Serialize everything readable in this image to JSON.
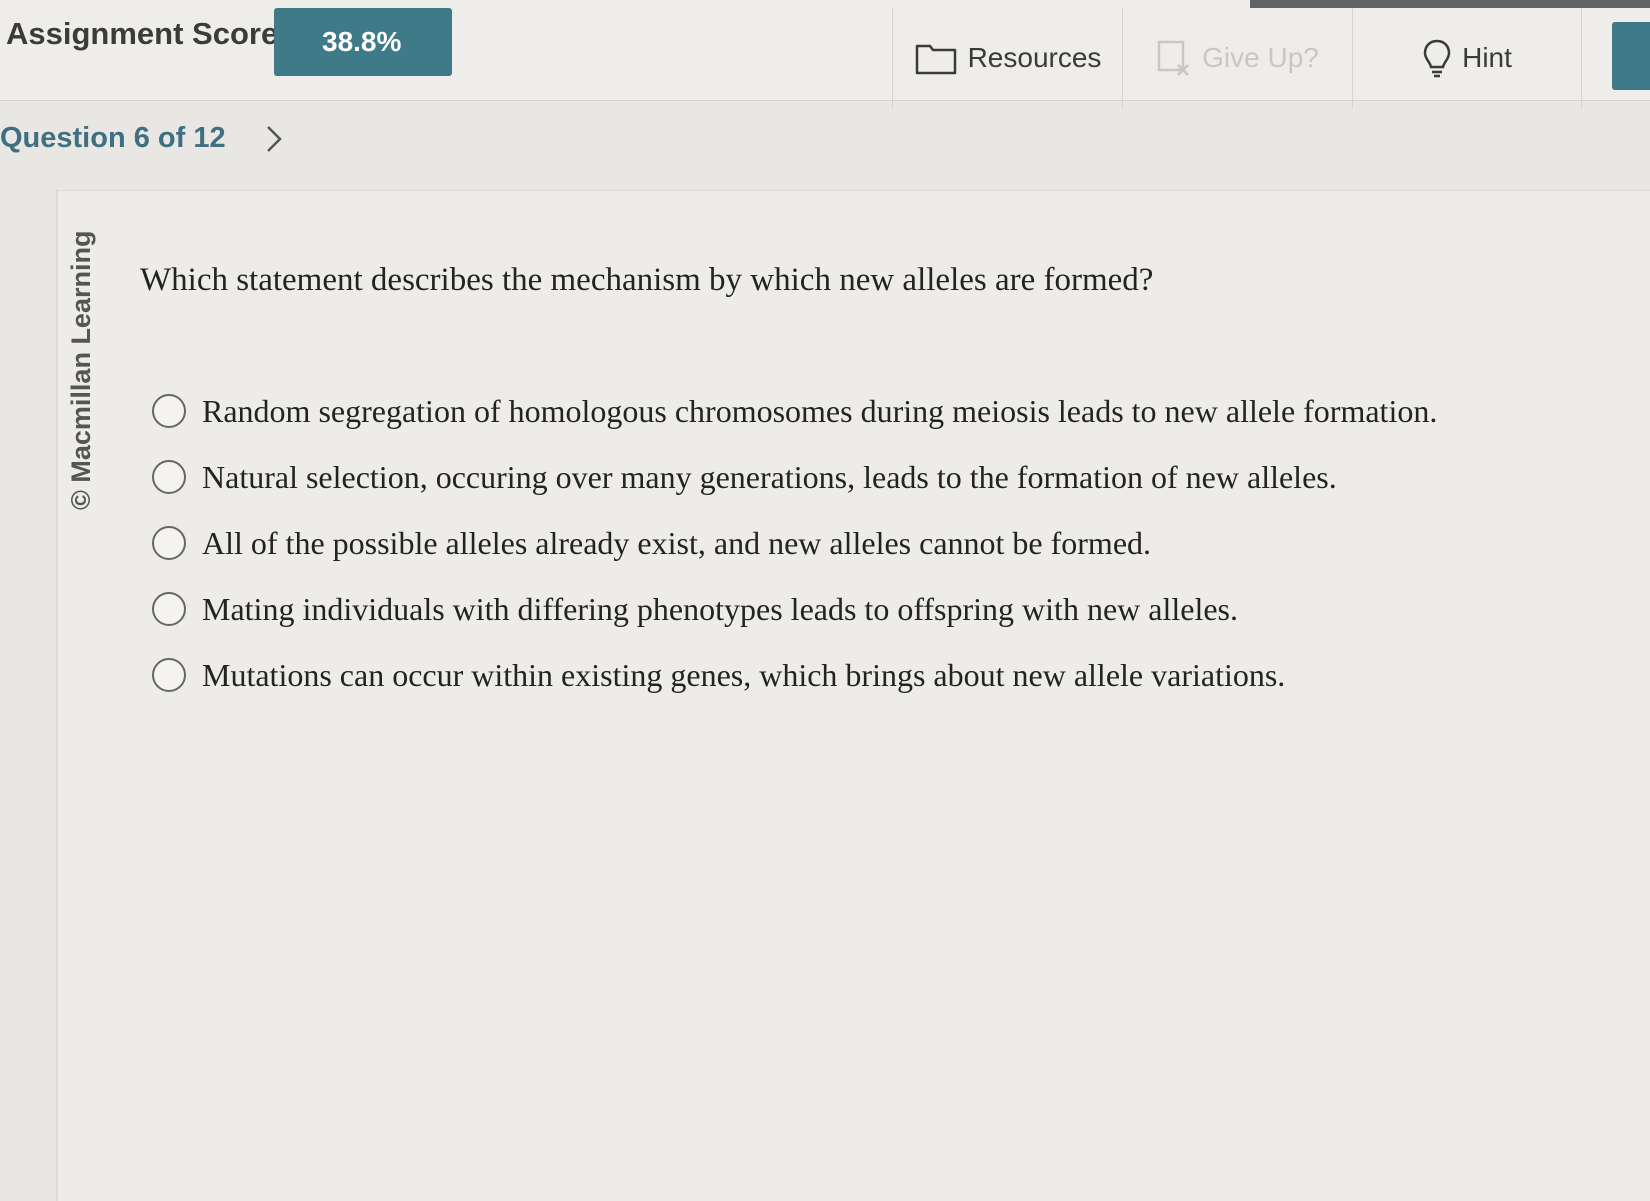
{
  "header": {
    "score_label": "Assignment Score:",
    "score_value": "38.8%",
    "tools": {
      "resources": {
        "label": "Resources",
        "icon": "folder-icon"
      },
      "give_up": {
        "label": "Give Up?",
        "icon": "give-up-icon",
        "disabled": true
      },
      "hint": {
        "label": "Hint",
        "icon": "lightbulb-icon"
      }
    }
  },
  "question_nav": {
    "label": "Question 6 of 12",
    "next_icon": "chevron-right-icon"
  },
  "card": {
    "copyright": "© Macmillan Learning",
    "question": "Which statement describes the mechanism by which new alleles are formed?",
    "options": [
      {
        "label": "Random segregation of homologous chromosomes during meiosis leads to new allele formation."
      },
      {
        "label": "Natural selection, occuring over many generations, leads to the formation of new alleles."
      },
      {
        "label": "All of the possible alleles already exist, and new alleles cannot be formed."
      },
      {
        "label": "Mating individuals with differing phenotypes leads to offspring with new alleles."
      },
      {
        "label": "Mutations can occur within existing genes, which brings about new allele variations."
      }
    ]
  },
  "colors": {
    "accent": "#3f7a88",
    "nav_text": "#3f6f80",
    "disabled_text": "#c9c7c3",
    "background": "#e9e7e3"
  }
}
